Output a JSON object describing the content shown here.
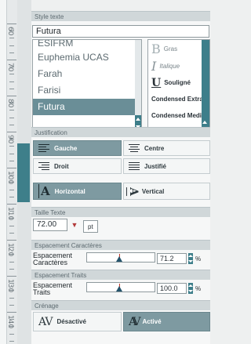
{
  "ruler": {
    "labels": [
      "60",
      "70",
      "80",
      "90",
      "100",
      "110",
      "120",
      "130",
      "140"
    ]
  },
  "sections": {
    "style_texte": "Style texte",
    "justification": "Justification",
    "taille_texte": "Taille Texte",
    "espacement_caracteres": "Espacement Caractères",
    "espacement_traits": "Espacement Traits",
    "crenage": "Crénage"
  },
  "font": {
    "current_value": "Futura",
    "list": [
      "ESIFRM",
      "Euphemia UCAS",
      "Farah",
      "Farisi",
      "Futura"
    ],
    "selected": "Futura"
  },
  "styles": {
    "gras": "Gras",
    "italique": "Italique",
    "souligne": "Souligné",
    "condensed_extra": "Condensed Extra",
    "condensed_medi": "Condensed Medi",
    "gras_glyph": "B",
    "italique_glyph": "I",
    "souligne_glyph": "U"
  },
  "justification": {
    "gauche": "Gauche",
    "centre": "Centre",
    "droit": "Droit",
    "justifie": "Justifié",
    "horizontal": "Horizontal",
    "vertical": "Vertical",
    "horizontal_glyph": "A",
    "vertical_glyph": "A"
  },
  "taille": {
    "value": "72.00",
    "dropdown_glyph": "▼",
    "unit": "pt"
  },
  "espacement_caracteres": {
    "label_line1": "Espacement",
    "label_line2": "Caractères",
    "value": "71.2",
    "unit": "%"
  },
  "espacement_traits": {
    "label_line1": "Espacement",
    "label_line2": "Traits",
    "value": "100.0",
    "unit": "%"
  },
  "crenage": {
    "desactive": "Désactivé",
    "active": "Activé",
    "glyph": "AV"
  },
  "colors": {
    "accent": "#3d7e8a",
    "active_button": "#7e9aa1",
    "selection": "#6a8e97"
  }
}
